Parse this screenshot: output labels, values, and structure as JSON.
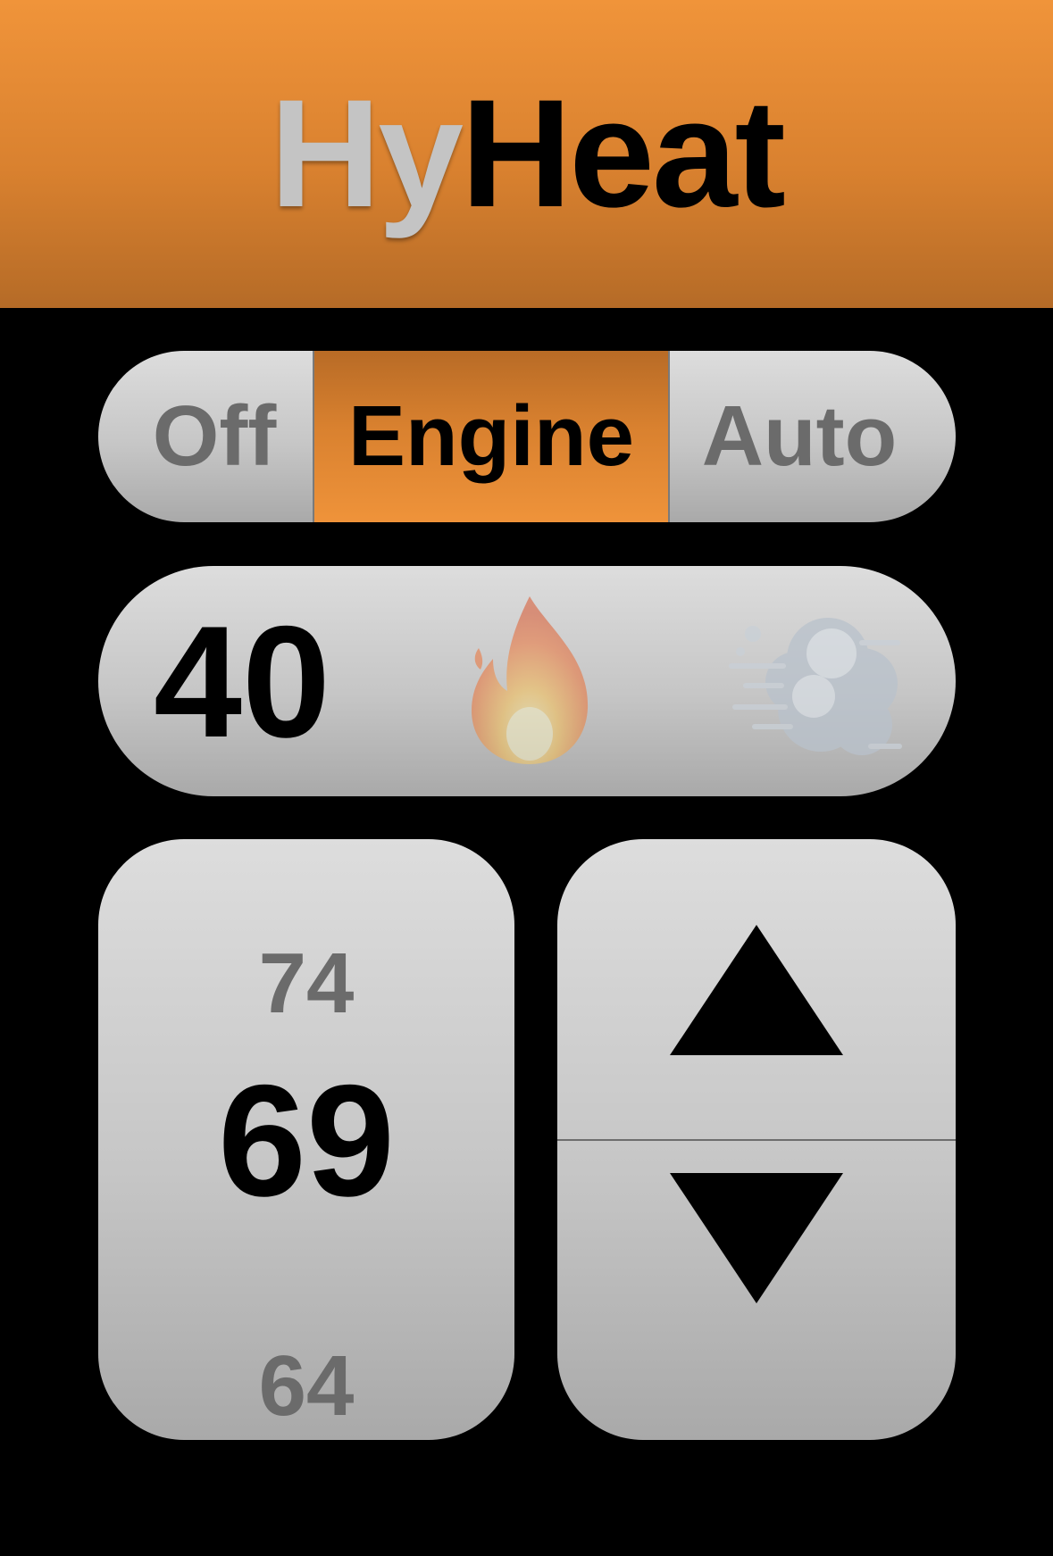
{
  "header": {
    "title_part1": "Hy",
    "title_part2": "Heat",
    "accent_color": "#ef933a",
    "title_part1_color": "#c4c4c4"
  },
  "mode": {
    "options": [
      "Off",
      "Engine",
      "Auto"
    ],
    "selected": "Engine"
  },
  "status": {
    "value": "40",
    "indicators": [
      {
        "icon": "flame-icon",
        "active": false
      },
      {
        "icon": "wind-icon",
        "active": false
      }
    ]
  },
  "setpoint": {
    "upper": "74",
    "current": "69",
    "lower": "64"
  },
  "stepper": {
    "up_icon": "triangle-up-icon",
    "down_icon": "triangle-down-icon"
  }
}
